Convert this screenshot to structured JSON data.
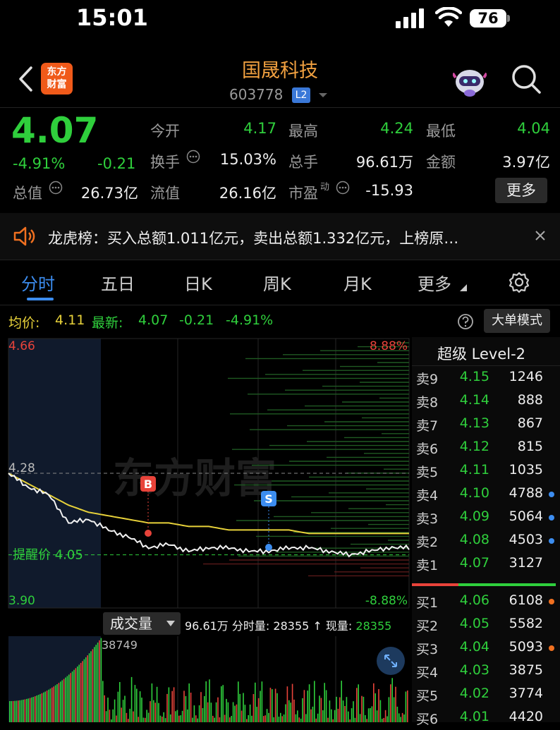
{
  "status_bar": {
    "time": "15:01",
    "battery": "76"
  },
  "header": {
    "logo_line1": "东方",
    "logo_line2": "财富",
    "stock_name": "国晟科技",
    "stock_code": "603778",
    "level_badge": "L2"
  },
  "quote": {
    "last_price": "4.07",
    "change_pct": "-4.91%",
    "change": "-0.21",
    "fields": {
      "open_label": "今开",
      "open": "4.17",
      "high_label": "最高",
      "high": "4.24",
      "low_label": "最低",
      "low": "4.04",
      "turnover_label": "换手",
      "turnover": "15.03%",
      "volume_label": "总手",
      "volume": "96.61万",
      "amount_label": "金额",
      "amount": "3.97亿",
      "mktcap_label": "总值",
      "mktcap": "26.73亿",
      "float_label": "流值",
      "float": "26.16亿",
      "pe_label": "市盈",
      "pe_sup": "动",
      "pe": "-15.93"
    },
    "more_button": "更多"
  },
  "notice": {
    "text": "龙虎榜：买入总额1.011亿元，卖出总额1.332亿元，上榜原…"
  },
  "tabs": [
    "分时",
    "五日",
    "日K",
    "周K",
    "月K",
    "更多"
  ],
  "info_line": {
    "avg_label": "均价:",
    "avg": "4.11",
    "latest_label": "最新:",
    "latest": "4.07",
    "change": "-0.21",
    "change_pct": "-4.91%",
    "big_order_button": "大单模式"
  },
  "chart": {
    "price_max": "4.66",
    "price_min": "3.90",
    "pct_max": "8.88%",
    "pct_min": "-8.88%",
    "prev_close_label": "4.28",
    "alert_label": "提醒价 4.05",
    "watermark": "东方财富",
    "marker_buy": "B",
    "marker_sell": "S",
    "volume_max_label": "38749"
  },
  "chart_data": {
    "type": "line",
    "y_range": [
      3.9,
      4.66
    ],
    "prev_close": 4.28,
    "alert_price": 4.05,
    "series": [
      {
        "values": [
          4.28,
          4.24,
          4.22,
          4.14,
          4.15,
          4.12,
          4.1,
          4.07,
          4.08,
          4.06,
          4.07,
          4.07,
          4.06,
          4.06,
          4.07,
          4.07,
          4.06,
          4.05,
          4.06,
          4.07,
          4.07
        ]
      },
      {
        "values": [
          4.28,
          4.25,
          4.22,
          4.19,
          4.17,
          4.16,
          4.15,
          4.14,
          4.14,
          4.13,
          4.13,
          4.12,
          4.12,
          4.12,
          4.12,
          4.11,
          4.11,
          4.11,
          4.11,
          4.11,
          4.11
        ]
      }
    ]
  },
  "order_book": {
    "title": "超级 Level-2",
    "asks": [
      {
        "label": "卖9",
        "price": "4.15",
        "volume": "1246",
        "dot": ""
      },
      {
        "label": "卖8",
        "price": "4.14",
        "volume": "888",
        "dot": ""
      },
      {
        "label": "卖7",
        "price": "4.13",
        "volume": "867",
        "dot": ""
      },
      {
        "label": "卖6",
        "price": "4.12",
        "volume": "815",
        "dot": ""
      },
      {
        "label": "卖5",
        "price": "4.11",
        "volume": "1035",
        "dot": ""
      },
      {
        "label": "卖4",
        "price": "4.10",
        "volume": "4788",
        "dot": "#3c8df0"
      },
      {
        "label": "卖3",
        "price": "4.09",
        "volume": "5064",
        "dot": "#3c8df0"
      },
      {
        "label": "卖2",
        "price": "4.08",
        "volume": "4503",
        "dot": "#3c8df0"
      },
      {
        "label": "卖1",
        "price": "4.07",
        "volume": "3127",
        "dot": ""
      }
    ],
    "bids": [
      {
        "label": "买1",
        "price": "4.06",
        "volume": "6108",
        "dot": "#f07020"
      },
      {
        "label": "买2",
        "price": "4.05",
        "volume": "5582",
        "dot": ""
      },
      {
        "label": "买3",
        "price": "4.04",
        "volume": "5093",
        "dot": "#f07020"
      },
      {
        "label": "买4",
        "price": "4.03",
        "volume": "3875",
        "dot": ""
      },
      {
        "label": "买5",
        "price": "4.02",
        "volume": "3774",
        "dot": ""
      },
      {
        "label": "买6",
        "price": "4.01",
        "volume": "4420",
        "dot": ""
      }
    ]
  },
  "volume_bar": {
    "select_label": "成交量",
    "total": "96.61万",
    "period_label": "分时量:",
    "period_value": "28355",
    "now_label": "现量:",
    "now_value": "28355"
  },
  "colors": {
    "up": "#e8433a",
    "down": "#2fcf3c",
    "accent": "#3c8df0",
    "avg_line": "#e8d23a",
    "brand": "#f05a1a",
    "title": "#f0a040"
  }
}
